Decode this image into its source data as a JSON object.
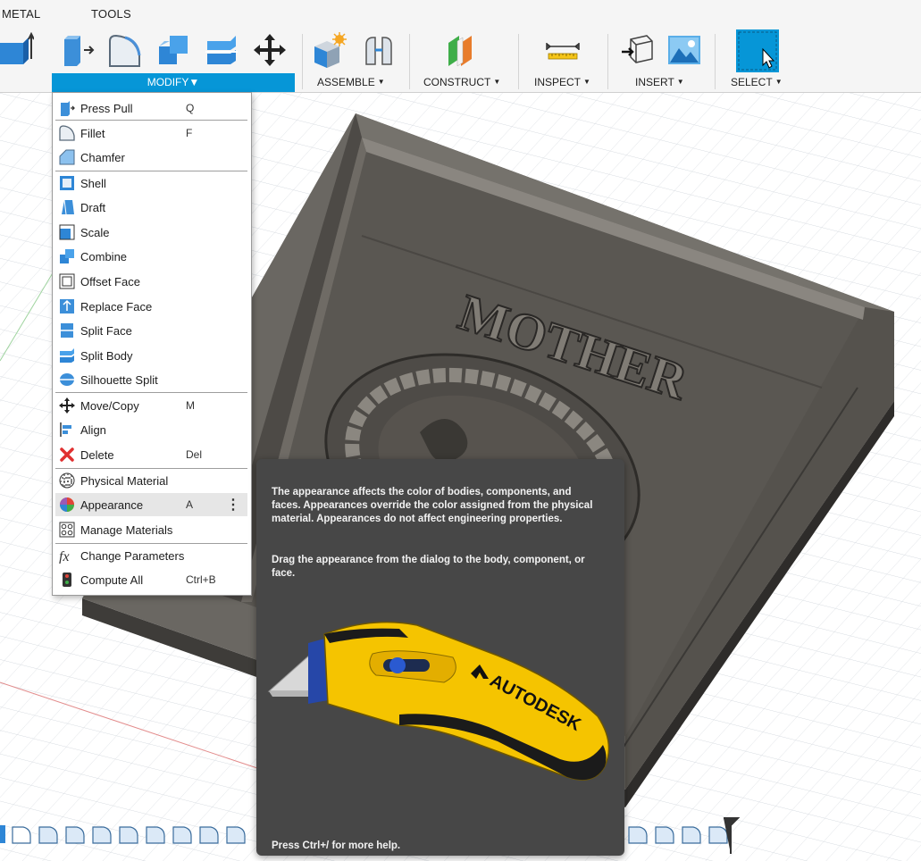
{
  "toolbar": {
    "tabs": [
      "METAL",
      "TOOLS"
    ],
    "groups": [
      {
        "label": "MODIFY",
        "caret": "▼"
      },
      {
        "label": "ASSEMBLE",
        "caret": "▼"
      },
      {
        "label": "CONSTRUCT",
        "caret": "▼"
      },
      {
        "label": "INSPECT",
        "caret": "▼"
      },
      {
        "label": "INSERT",
        "caret": "▼"
      },
      {
        "label": "SELECT",
        "caret": "▼"
      }
    ],
    "icons": [
      "extrude-icon",
      "press-pull-icon",
      "fillet-icon",
      "combine-icon",
      "split-body-icon",
      "move-icon",
      "new-component-icon",
      "joint-icon",
      "offset-plane-icon",
      "measure-icon",
      "insert-mesh-icon",
      "insert-canvas-icon",
      "select-icon"
    ]
  },
  "menu": {
    "items": [
      {
        "label": "Press Pull",
        "shortcut": "Q",
        "icon": "press-pull-icon"
      },
      {
        "label": "Fillet",
        "shortcut": "F",
        "icon": "fillet-icon"
      },
      {
        "label": "Chamfer",
        "shortcut": "",
        "icon": "chamfer-icon"
      },
      {
        "label": "Shell",
        "shortcut": "",
        "icon": "shell-icon"
      },
      {
        "label": "Draft",
        "shortcut": "",
        "icon": "draft-icon"
      },
      {
        "label": "Scale",
        "shortcut": "",
        "icon": "scale-icon"
      },
      {
        "label": "Combine",
        "shortcut": "",
        "icon": "combine-icon"
      },
      {
        "label": "Offset Face",
        "shortcut": "",
        "icon": "offset-face-icon"
      },
      {
        "label": "Replace Face",
        "shortcut": "",
        "icon": "replace-face-icon"
      },
      {
        "label": "Split Face",
        "shortcut": "",
        "icon": "split-face-icon"
      },
      {
        "label": "Split Body",
        "shortcut": "",
        "icon": "split-body-icon"
      },
      {
        "label": "Silhouette Split",
        "shortcut": "",
        "icon": "silhouette-split-icon"
      },
      {
        "label": "Move/Copy",
        "shortcut": "M",
        "icon": "move-copy-icon"
      },
      {
        "label": "Align",
        "shortcut": "",
        "icon": "align-icon"
      },
      {
        "label": "Delete",
        "shortcut": "Del",
        "icon": "delete-icon"
      },
      {
        "label": "Physical Material",
        "shortcut": "",
        "icon": "physical-material-icon"
      },
      {
        "label": "Appearance",
        "shortcut": "A",
        "icon": "appearance-icon",
        "more": "⋮"
      },
      {
        "label": "Manage Materials",
        "shortcut": "",
        "icon": "manage-materials-icon"
      },
      {
        "label": "Change Parameters",
        "shortcut": "",
        "icon": "change-parameters-icon"
      },
      {
        "label": "Compute All",
        "shortcut": "Ctrl+B",
        "icon": "compute-all-icon"
      }
    ]
  },
  "tooltip": {
    "paragraph1": "The appearance affects the color of bodies, components, and faces. Appearances override the color assigned from the physical material. Appearances do not affect engineering properties.",
    "paragraph2": "Drag the appearance from the dialog to the body, component, or face.",
    "footer": "Press Ctrl+/ for more help.",
    "image_brand": "AUTODESK"
  },
  "scene": {
    "model_text": "MOTHER"
  },
  "colors": {
    "accent": "#0696d7",
    "tooltip_bg": "#474747",
    "model": "#5e5b56"
  }
}
